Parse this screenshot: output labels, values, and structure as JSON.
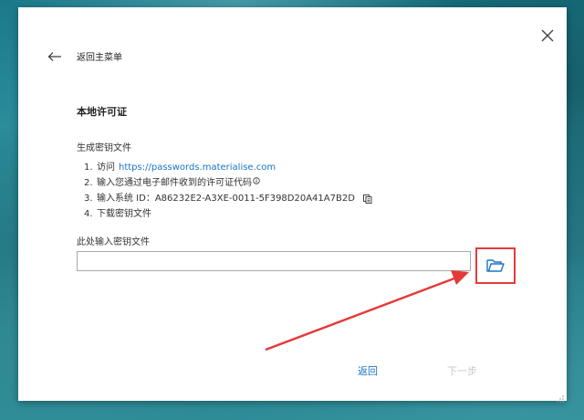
{
  "dialog": {
    "back_label": "返回主菜单",
    "section_title": "本地许可证",
    "subsection_title": "生成密钥文件",
    "steps": [
      {
        "num": "1.",
        "text": "访问",
        "link": "https://passwords.materialise.com"
      },
      {
        "num": "2.",
        "text": "输入您通过电子邮件收到的许可证代码"
      },
      {
        "num": "3.",
        "text": "输入系统 ID：A86232E2-A3XE-0011-5F398D20A41A7B2D"
      },
      {
        "num": "4.",
        "text": "下载密钥文件"
      }
    ],
    "key_file_label": "此处输入密钥文件",
    "key_file_value": "",
    "back_button": "返回",
    "next_button": "下一步"
  },
  "icons": {
    "close": "close-icon",
    "back_arrow": "arrow-left-icon",
    "info": "info-icon",
    "copy": "copy-icon",
    "folder": "folder-open-icon",
    "resize": "resize-grip-icon"
  },
  "colors": {
    "link": "#1a73c8",
    "folder_icon": "#1a73c8",
    "disabled_text": "#c7c7c7",
    "annotation": "#e53a3a",
    "background": "#2b8c9a"
  }
}
